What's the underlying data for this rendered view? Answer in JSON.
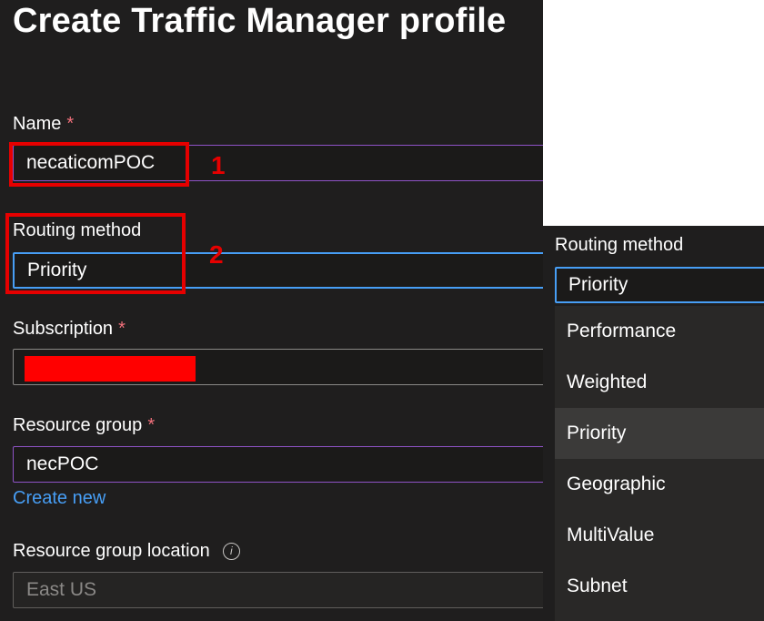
{
  "header": {
    "title": "Create Traffic Manager profile"
  },
  "form": {
    "name": {
      "label": "Name",
      "required_mark": "*",
      "value": "necaticomPOC"
    },
    "routing_method": {
      "label": "Routing method",
      "value": "Priority"
    },
    "subscription": {
      "label": "Subscription",
      "required_mark": "*",
      "value": ""
    },
    "resource_group": {
      "label": "Resource group",
      "required_mark": "*",
      "value": "necPOC",
      "create_new_label": "Create new"
    },
    "resource_group_location": {
      "label": "Resource group location",
      "info_icon": "i",
      "value": "East US"
    }
  },
  "annotations": {
    "step1": "1",
    "step2": "2"
  },
  "dropdown": {
    "label": "Routing method",
    "selected_value": "Priority",
    "options": [
      "Performance",
      "Weighted",
      "Priority",
      "Geographic",
      "MultiValue",
      "Subnet"
    ],
    "highlighted_option": "Priority"
  },
  "colors": {
    "background": "#1f1e1e",
    "accent_blue": "#479ef5",
    "focus_purple": "#8f53c7",
    "required_red": "#f1707b",
    "annotation_red": "#e60000",
    "redaction": "#ff0000"
  }
}
